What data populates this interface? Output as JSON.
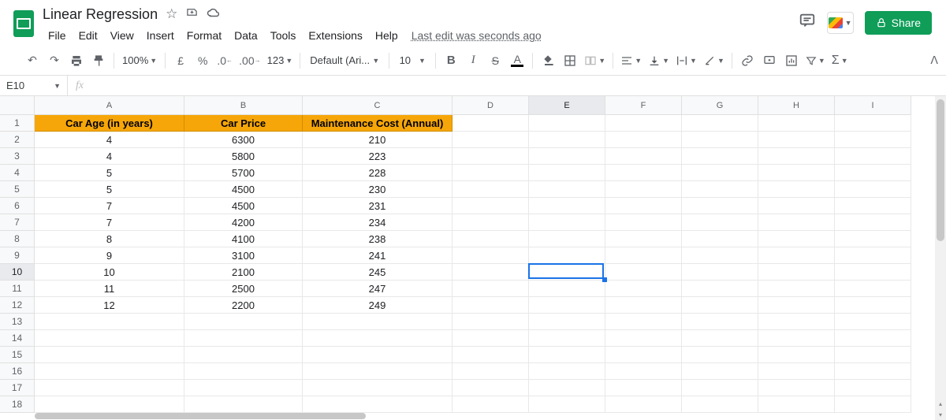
{
  "doc": {
    "title": "Linear Regression"
  },
  "menus": [
    "File",
    "Edit",
    "View",
    "Insert",
    "Format",
    "Data",
    "Tools",
    "Extensions",
    "Help"
  ],
  "last_edit": "Last edit was seconds ago",
  "share_label": "Share",
  "toolbar": {
    "zoom": "100%",
    "font": "Default (Ari...",
    "font_size": "10"
  },
  "name_box": "E10",
  "formula": "",
  "columns": [
    "A",
    "B",
    "C",
    "D",
    "E",
    "F",
    "G",
    "H",
    "I"
  ],
  "row_count": 18,
  "selected": {
    "row": 10,
    "col": "E"
  },
  "chart_data": {
    "type": "table",
    "title": "Linear Regression",
    "headers": [
      "Car Age (in years)",
      "Car Price",
      "Maintenance Cost (Annual)"
    ],
    "rows": [
      [
        4,
        6300,
        210
      ],
      [
        4,
        5800,
        223
      ],
      [
        5,
        5700,
        228
      ],
      [
        5,
        4500,
        230
      ],
      [
        7,
        4500,
        231
      ],
      [
        7,
        4200,
        234
      ],
      [
        8,
        4100,
        238
      ],
      [
        9,
        3100,
        241
      ],
      [
        10,
        2100,
        245
      ],
      [
        11,
        2500,
        247
      ],
      [
        12,
        2200,
        249
      ]
    ]
  }
}
